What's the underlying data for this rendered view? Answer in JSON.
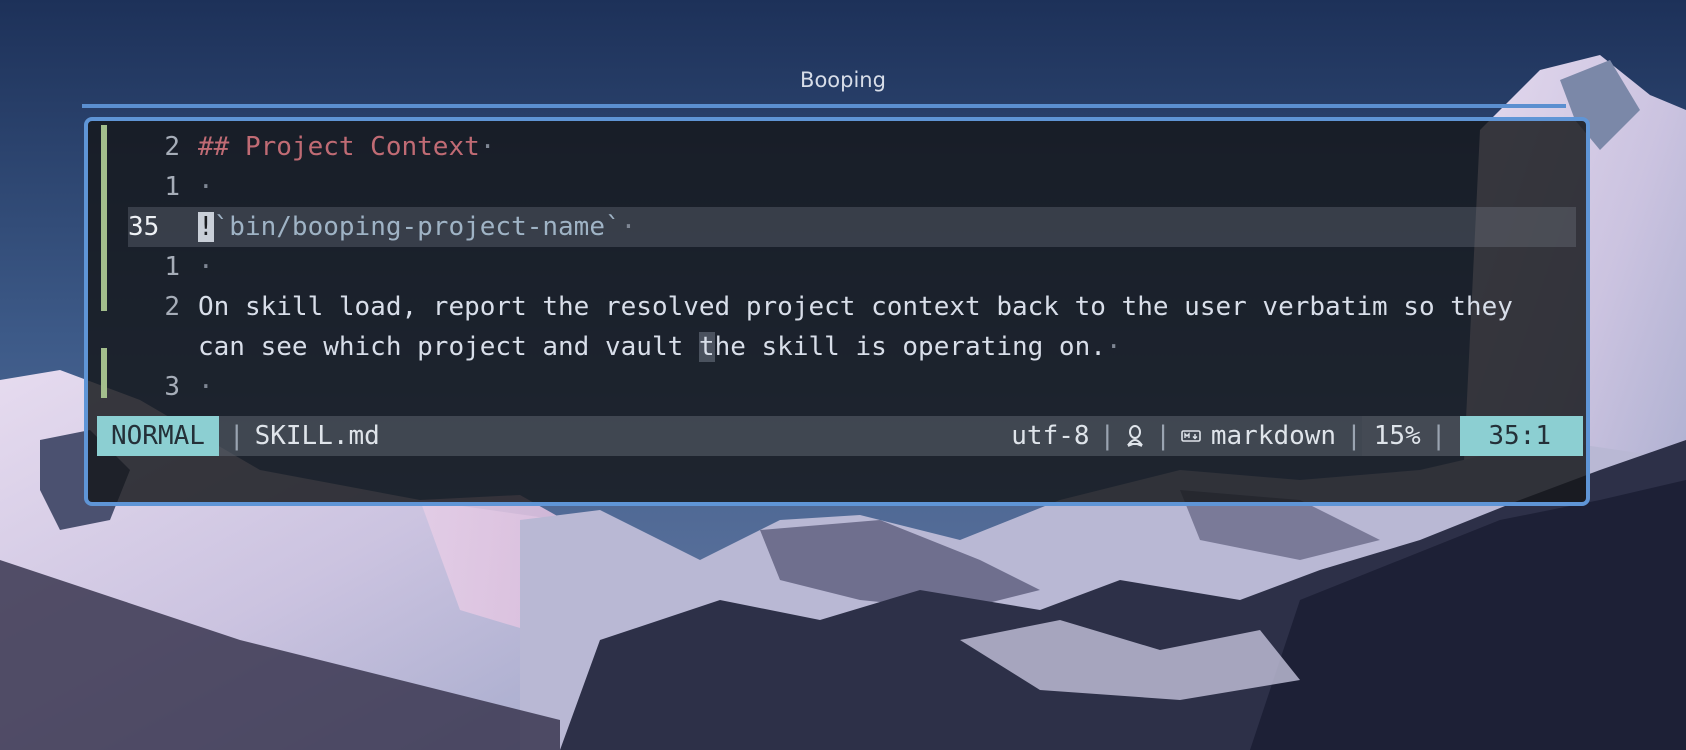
{
  "window": {
    "title": "Booping"
  },
  "editor": {
    "lines": [
      {
        "num": "2",
        "kind": "heading",
        "text": "## Project Context",
        "eol": "·"
      },
      {
        "num": "1",
        "kind": "blank",
        "text": "",
        "eol": "·"
      },
      {
        "num": "35",
        "kind": "current",
        "cursor_char": "!",
        "text": "`bin/booping-project-name`",
        "eol": "·"
      },
      {
        "num": "1",
        "kind": "blank",
        "text": "",
        "eol": "·"
      },
      {
        "num": "2",
        "kind": "wrapped",
        "text": "On skill load, report the resolved project context back to the user verbatim so they",
        "wrap_a": "can see which project and vault ",
        "wrap_cursor": "t",
        "wrap_b": "he skill is operating on.",
        "eol": "·"
      },
      {
        "num": "3",
        "kind": "blank",
        "text": "",
        "eol": "·"
      }
    ]
  },
  "statusline": {
    "mode": "NORMAL",
    "separator": "|",
    "filename": "SKILL.md",
    "encoding": "utf-8",
    "os_icon": "linux-tux-icon",
    "filetype_icon": "markdown-icon",
    "filetype": "markdown",
    "percent": "15%",
    "position": "35:1"
  },
  "colors": {
    "accent_border": "#5f95d6",
    "mode_bg": "#8ccfd2",
    "heading": "#c06b74",
    "gutter_git": "#a3be8c"
  }
}
